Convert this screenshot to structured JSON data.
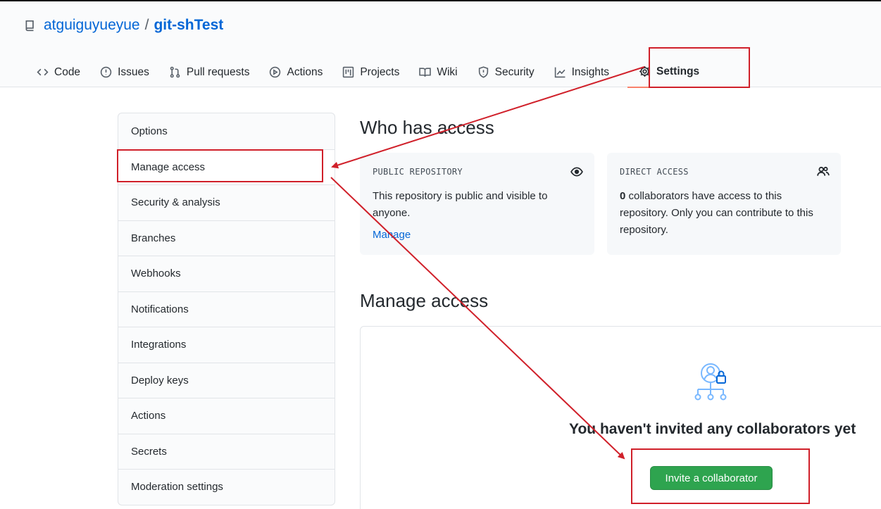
{
  "repo": {
    "owner": "atguiguyueyue",
    "separator": "/",
    "name": "git-shTest"
  },
  "tabs": [
    {
      "label": "Code",
      "icon": "code-icon"
    },
    {
      "label": "Issues",
      "icon": "issue-icon"
    },
    {
      "label": "Pull requests",
      "icon": "pull-request-icon"
    },
    {
      "label": "Actions",
      "icon": "play-icon"
    },
    {
      "label": "Projects",
      "icon": "project-icon"
    },
    {
      "label": "Wiki",
      "icon": "book-icon"
    },
    {
      "label": "Security",
      "icon": "shield-icon"
    },
    {
      "label": "Insights",
      "icon": "graph-icon"
    },
    {
      "label": "Settings",
      "icon": "gear-icon"
    }
  ],
  "sidebar": {
    "items": [
      {
        "label": "Options"
      },
      {
        "label": "Manage access"
      },
      {
        "label": "Security & analysis"
      },
      {
        "label": "Branches"
      },
      {
        "label": "Webhooks"
      },
      {
        "label": "Notifications"
      },
      {
        "label": "Integrations"
      },
      {
        "label": "Deploy keys"
      },
      {
        "label": "Actions"
      },
      {
        "label": "Secrets"
      },
      {
        "label": "Moderation settings"
      }
    ]
  },
  "who_has_access": {
    "title": "Who has access",
    "public_card": {
      "label": "PUBLIC REPOSITORY",
      "text": "This repository is public and visible to anyone.",
      "link": "Manage",
      "icon": "eye-icon"
    },
    "direct_card": {
      "label": "DIRECT ACCESS",
      "count": "0",
      "text": " collaborators have access to this repository. Only you can contribute to this repository.",
      "icon": "people-icon"
    }
  },
  "manage_access": {
    "title": "Manage access",
    "empty_message": "You haven't invited any collaborators yet",
    "invite_button": "Invite a collaborator",
    "icon": "collaborators-icon"
  },
  "colors": {
    "link": "#0366d6",
    "primary_button": "#2ea44f",
    "annotation": "#d0202a",
    "tab_underline": "#f9826c"
  }
}
